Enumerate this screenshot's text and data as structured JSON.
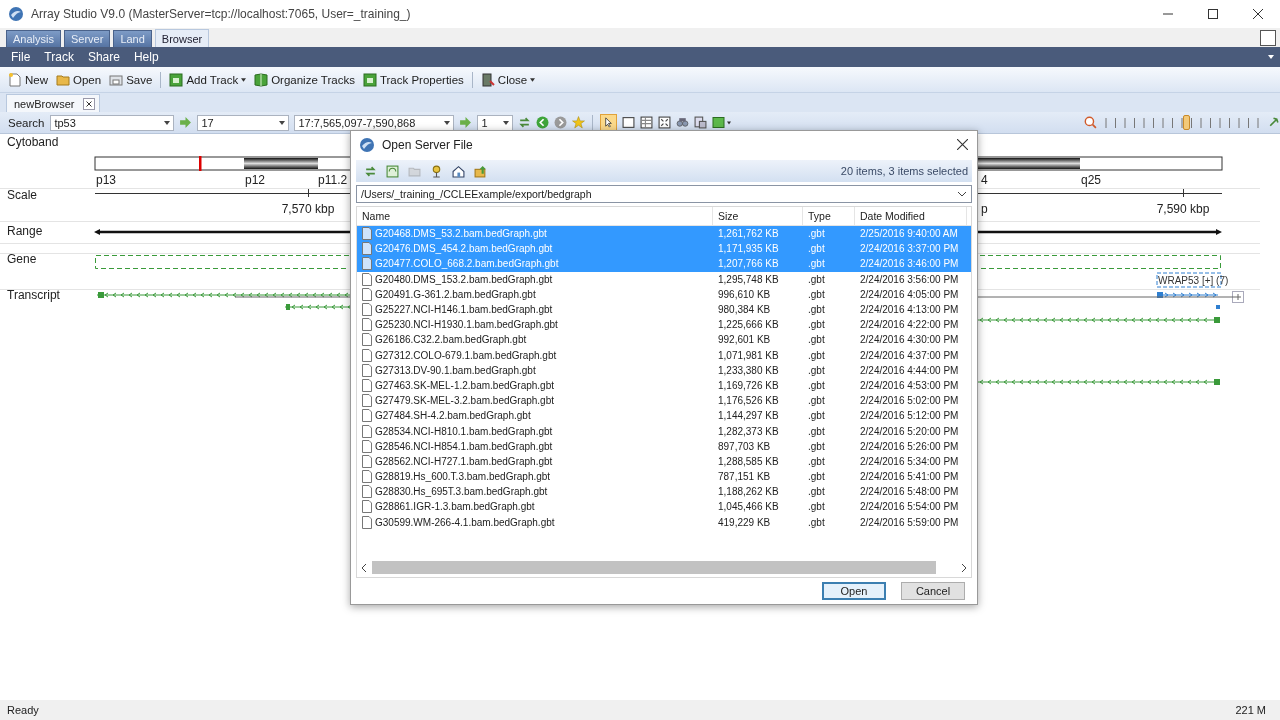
{
  "window": {
    "title": "Array Studio V9.0 (MasterServer=tcp://localhost:7065, User=_training_)"
  },
  "ribbon_tabs": [
    {
      "label": "Analysis",
      "selected": false
    },
    {
      "label": "Server",
      "selected": false
    },
    {
      "label": "Land",
      "selected": false
    },
    {
      "label": "Browser",
      "selected": true
    }
  ],
  "menu": [
    "File",
    "Track",
    "Share",
    "Help"
  ],
  "toolbar": [
    {
      "label": "New",
      "kind": "new",
      "dropdown": false
    },
    {
      "label": "Open",
      "kind": "open",
      "dropdown": false
    },
    {
      "label": "Save",
      "kind": "save",
      "dropdown": false
    },
    {
      "label": "Add Track",
      "kind": "track",
      "dropdown": true
    },
    {
      "label": "Organize Tracks",
      "kind": "organize",
      "dropdown": false
    },
    {
      "label": "Track Properties",
      "kind": "track",
      "dropdown": false
    },
    {
      "label": "Close",
      "kind": "close",
      "dropdown": true
    }
  ],
  "document_tabs": [
    {
      "label": "newBrowser",
      "selected": true
    }
  ],
  "search_bar": {
    "label": "Search",
    "query": "tp53",
    "chromosome": "17",
    "region": "17:7,565,097-7,590,868",
    "frame": "1"
  },
  "zoom_slider": {
    "level": 0.53
  },
  "tracks": [
    {
      "name": "Cytoband",
      "kind": "cytoband",
      "labels": [
        "p13",
        "p12",
        "p11.2",
        "4",
        "q25"
      ]
    },
    {
      "name": "Scale",
      "kind": "scale",
      "labels": [
        "7,570 kbp",
        "p",
        "7,590 kbp"
      ]
    },
    {
      "name": "Range",
      "kind": "range"
    },
    {
      "name": "Gene",
      "kind": "gene",
      "labels": [
        "WRAP53 [+] (7)"
      ]
    },
    {
      "name": "Transcript",
      "kind": "transcript"
    }
  ],
  "dialog": {
    "title": "Open Server File",
    "summary": "20 items, 3 items selected",
    "path": "/Users/_training_/CCLEExample/export/bedgraph",
    "columns": [
      "Name",
      "Size",
      "Type",
      "Date Modified"
    ],
    "files": [
      {
        "name": "G20468.DMS_53.2.bam.bedGraph.gbt",
        "size": "1,261,762 KB",
        "type": ".gbt",
        "modified": "2/25/2016 9:40:00 AM",
        "selected": true
      },
      {
        "name": "G20476.DMS_454.2.bam.bedGraph.gbt",
        "size": "1,171,935 KB",
        "type": ".gbt",
        "modified": "2/24/2016 3:37:00 PM",
        "selected": true
      },
      {
        "name": "G20477.COLO_668.2.bam.bedGraph.gbt",
        "size": "1,207,766 KB",
        "type": ".gbt",
        "modified": "2/24/2016 3:46:00 PM",
        "selected": true
      },
      {
        "name": "G20480.DMS_153.2.bam.bedGraph.gbt",
        "size": "1,295,748 KB",
        "type": ".gbt",
        "modified": "2/24/2016 3:56:00 PM",
        "selected": false
      },
      {
        "name": "G20491.G-361.2.bam.bedGraph.gbt",
        "size": "996,610 KB",
        "type": ".gbt",
        "modified": "2/24/2016 4:05:00 PM",
        "selected": false
      },
      {
        "name": "G25227.NCI-H146.1.bam.bedGraph.gbt",
        "size": "980,384 KB",
        "type": ".gbt",
        "modified": "2/24/2016 4:13:00 PM",
        "selected": false
      },
      {
        "name": "G25230.NCI-H1930.1.bam.bedGraph.gbt",
        "size": "1,225,666 KB",
        "type": ".gbt",
        "modified": "2/24/2016 4:22:00 PM",
        "selected": false
      },
      {
        "name": "G26186.C32.2.bam.bedGraph.gbt",
        "size": "992,601 KB",
        "type": ".gbt",
        "modified": "2/24/2016 4:30:00 PM",
        "selected": false
      },
      {
        "name": "G27312.COLO-679.1.bam.bedGraph.gbt",
        "size": "1,071,981 KB",
        "type": ".gbt",
        "modified": "2/24/2016 4:37:00 PM",
        "selected": false
      },
      {
        "name": "G27313.DV-90.1.bam.bedGraph.gbt",
        "size": "1,233,380 KB",
        "type": ".gbt",
        "modified": "2/24/2016 4:44:00 PM",
        "selected": false
      },
      {
        "name": "G27463.SK-MEL-1.2.bam.bedGraph.gbt",
        "size": "1,169,726 KB",
        "type": ".gbt",
        "modified": "2/24/2016 4:53:00 PM",
        "selected": false
      },
      {
        "name": "G27479.SK-MEL-3.2.bam.bedGraph.gbt",
        "size": "1,176,526 KB",
        "type": ".gbt",
        "modified": "2/24/2016 5:02:00 PM",
        "selected": false
      },
      {
        "name": "G27484.SH-4.2.bam.bedGraph.gbt",
        "size": "1,144,297 KB",
        "type": ".gbt",
        "modified": "2/24/2016 5:12:00 PM",
        "selected": false
      },
      {
        "name": "G28534.NCI-H810.1.bam.bedGraph.gbt",
        "size": "1,282,373 KB",
        "type": ".gbt",
        "modified": "2/24/2016 5:20:00 PM",
        "selected": false
      },
      {
        "name": "G28546.NCI-H854.1.bam.bedGraph.gbt",
        "size": "897,703 KB",
        "type": ".gbt",
        "modified": "2/24/2016 5:26:00 PM",
        "selected": false
      },
      {
        "name": "G28562.NCI-H727.1.bam.bedGraph.gbt",
        "size": "1,288,585 KB",
        "type": ".gbt",
        "modified": "2/24/2016 5:34:00 PM",
        "selected": false
      },
      {
        "name": "G28819.Hs_600.T.3.bam.bedGraph.gbt",
        "size": "787,151 KB",
        "type": ".gbt",
        "modified": "2/24/2016 5:41:00 PM",
        "selected": false
      },
      {
        "name": "G28830.Hs_695T.3.bam.bedGraph.gbt",
        "size": "1,188,262 KB",
        "type": ".gbt",
        "modified": "2/24/2016 5:48:00 PM",
        "selected": false
      },
      {
        "name": "G28861.IGR-1.3.bam.bedGraph.gbt",
        "size": "1,045,466 KB",
        "type": ".gbt",
        "modified": "2/24/2016 5:54:00 PM",
        "selected": false
      },
      {
        "name": "G30599.WM-266-4.1.bam.bedGraph.gbt",
        "size": "419,229 KB",
        "type": ".gbt",
        "modified": "2/24/2016 5:59:00 PM",
        "selected": false
      }
    ],
    "buttons": [
      {
        "label": "Open",
        "default": true
      },
      {
        "label": "Cancel",
        "default": false
      }
    ]
  },
  "status_bar": {
    "text": "Ready",
    "memory": "221 M"
  }
}
